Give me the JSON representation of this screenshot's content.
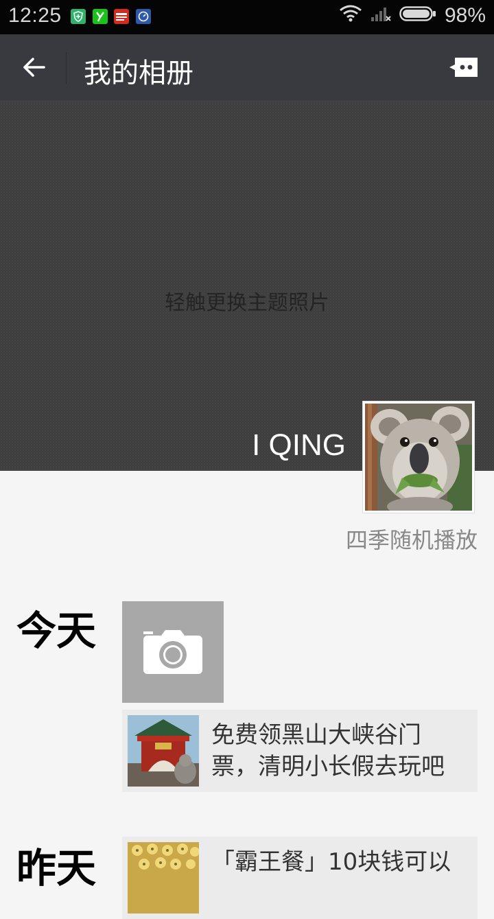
{
  "status_bar": {
    "time": "12:25",
    "battery_percent": "98%",
    "app_icons": [
      "shield-app-icon",
      "y-app-icon",
      "news-app-icon",
      "clock-app-icon"
    ]
  },
  "nav": {
    "title": "我的相册"
  },
  "cover": {
    "hint": "轻触更换主题照片",
    "username": "I QING",
    "signature": "四季随机播放"
  },
  "timeline": [
    {
      "day": "今天",
      "share_text": "免费领黑山大峡谷门票，清明小长假去玩吧"
    },
    {
      "day": "昨天",
      "share_text": "「霸王餐」10块钱可以"
    }
  ]
}
